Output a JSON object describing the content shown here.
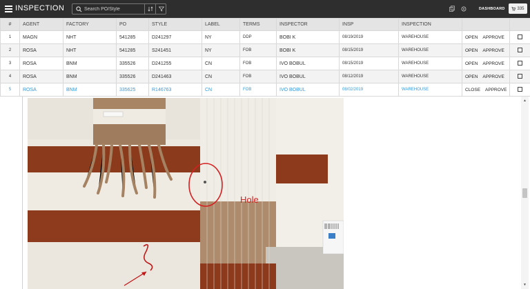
{
  "app": {
    "title": "INSPECTION"
  },
  "search": {
    "placeholder": "Search PO/Style"
  },
  "toolbar": {
    "dashboard_label": "DASHBOARD",
    "badge_count": "335"
  },
  "table": {
    "columns": [
      "#",
      "AGENT",
      "FACTORY",
      "PO",
      "STYLE",
      "LABEL",
      "TERMS",
      "INSPECTOR",
      "INSP",
      "INSPECTION"
    ],
    "rows": [
      {
        "num": "1",
        "agent": "MAGN",
        "factory": "NHT",
        "po": "541285",
        "style": "D241297",
        "label": "NY",
        "terms": "DDP",
        "inspector": "BOBI K",
        "insp": "08/19/2019",
        "inspection": "WAREHOUSE",
        "status": "OPEN",
        "action": "APPROVE"
      },
      {
        "num": "2",
        "agent": "ROSA",
        "factory": "NHT",
        "po": "541285",
        "style": "S241451",
        "label": "NY",
        "terms": "FOB",
        "inspector": "BOBI K",
        "insp": "08/15/2019",
        "inspection": "WAREHOUSE",
        "status": "OPEN",
        "action": "APPROVE"
      },
      {
        "num": "3",
        "agent": "ROSA",
        "factory": "BNM",
        "po": "335526",
        "style": "D241255",
        "label": "CN",
        "terms": "FOB",
        "inspector": "IVO BOBUL",
        "insp": "08/15/2019",
        "inspection": "WAREHOUSE",
        "status": "OPEN",
        "action": "APPROVE"
      },
      {
        "num": "4",
        "agent": "ROSA",
        "factory": "BNM",
        "po": "335526",
        "style": "D241463",
        "label": "CN",
        "terms": "FOB",
        "inspector": "IVO BOBUL",
        "insp": "08/12/2019",
        "inspection": "WAREHOUSE",
        "status": "OPEN",
        "action": "APPROVE"
      },
      {
        "num": "5",
        "agent": "ROSA",
        "factory": "BNM",
        "po": "335625",
        "style": "R146763",
        "label": "CN",
        "terms": "FOB",
        "inspector": "IVO BOBUL",
        "insp": "08/02/2019",
        "inspection": "WAREHOUSE",
        "status": "CLOSE",
        "action": "APPROVE"
      }
    ]
  },
  "photo": {
    "annotation": "Hole"
  },
  "colors": {
    "topbar": "#2e2e2e",
    "selected_row_text": "#3399dd",
    "header_bg": "#e4e4e4",
    "annotation_red": "#d42020"
  },
  "icons": [
    "menu-icon",
    "search-icon",
    "sort-icon",
    "filter-icon",
    "copy-icon",
    "gear-icon",
    "dashboard-icon",
    "cart-icon"
  ]
}
